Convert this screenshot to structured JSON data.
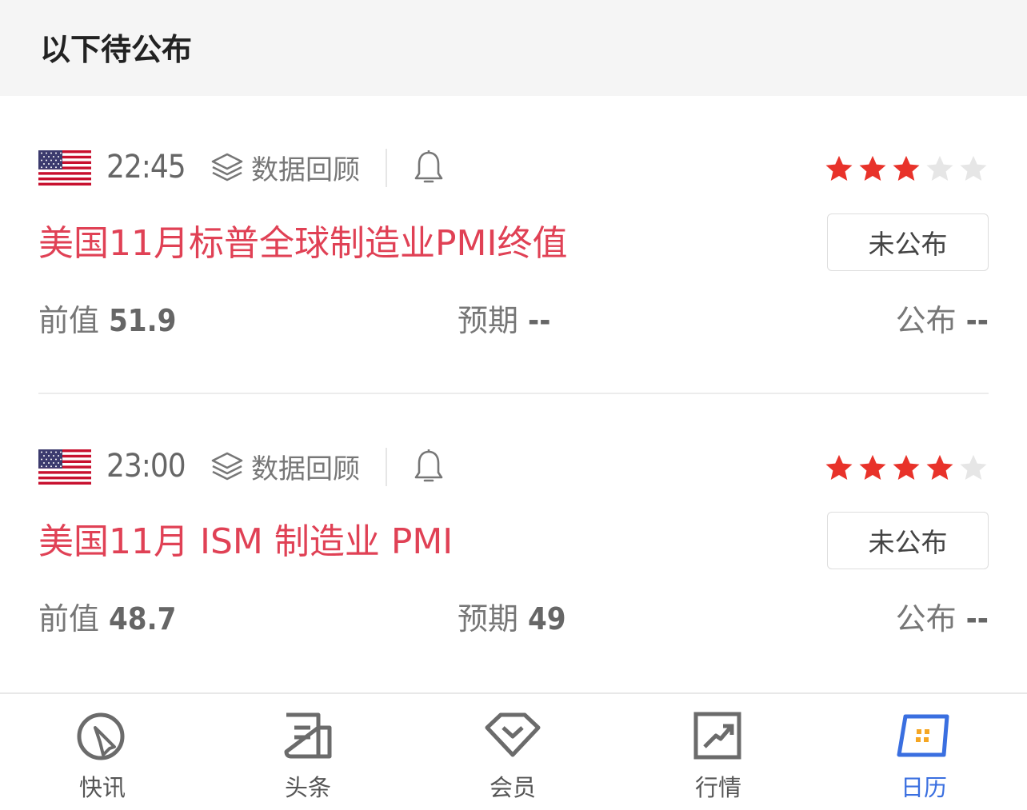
{
  "section": {
    "title": "以下待公布"
  },
  "events": [
    {
      "time": "22:45",
      "review_label": "数据回顾",
      "importance": 3,
      "title": "美国11月标普全球制造业PMI终值",
      "status": "未公布",
      "previous_label": "前值",
      "previous_value": "51.9",
      "forecast_label": "预期",
      "forecast_value": "--",
      "actual_label": "公布",
      "actual_value": "--"
    },
    {
      "time": "23:00",
      "review_label": "数据回顾",
      "importance": 4,
      "title": "美国11月 ISM 制造业 PMI",
      "status": "未公布",
      "previous_label": "前值",
      "previous_value": "48.7",
      "forecast_label": "预期",
      "forecast_value": "49",
      "actual_label": "公布",
      "actual_value": "--"
    }
  ],
  "colors": {
    "title_red": "#e04155",
    "star_on": "#e8322a",
    "star_off": "#e6e6e6",
    "active_tab": "#3a6fe0"
  },
  "tabbar": {
    "tabs": [
      {
        "label": "快讯",
        "icon": "flash-news-icon"
      },
      {
        "label": "头条",
        "icon": "newspaper-icon"
      },
      {
        "label": "会员",
        "icon": "diamond-icon"
      },
      {
        "label": "行情",
        "icon": "trend-chart-icon"
      },
      {
        "label": "日历",
        "icon": "calendar-icon",
        "active": true
      }
    ]
  }
}
